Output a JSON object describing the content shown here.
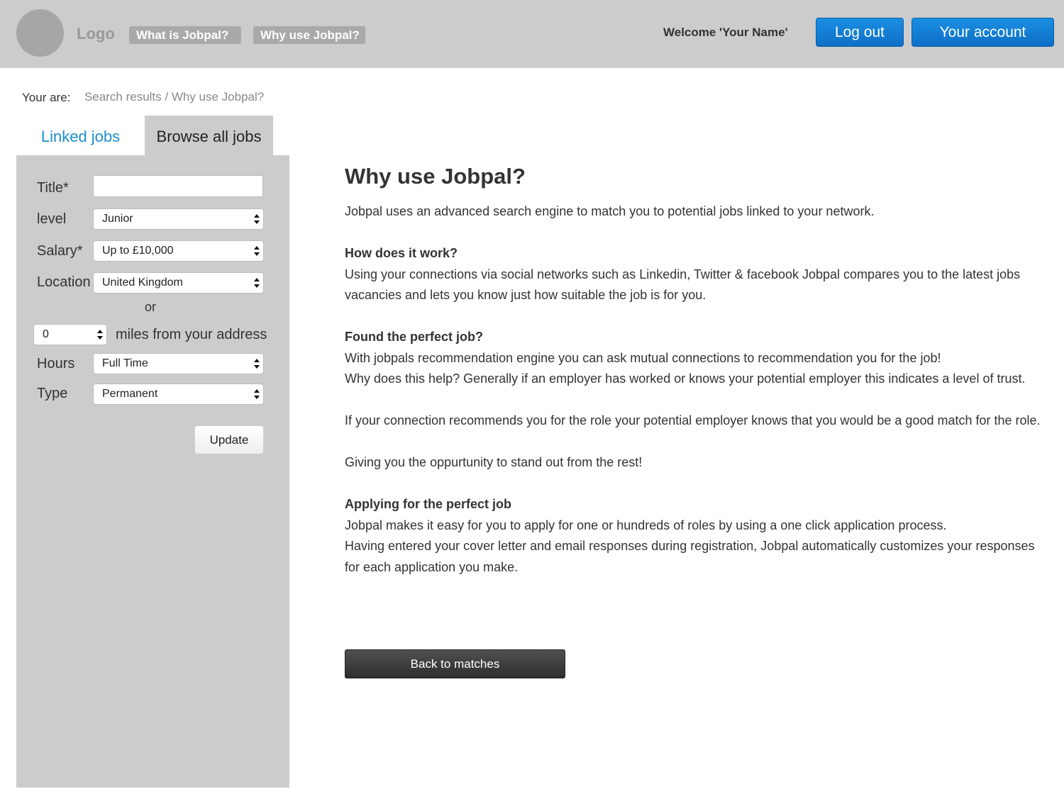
{
  "header": {
    "logo": "Logo",
    "nav": [
      "What is Jobpal?",
      "Why use Jobpal?"
    ],
    "welcome": "Welcome 'Your Name'",
    "logout_label": "Log out",
    "account_label": "Your account"
  },
  "breadcrumb": {
    "label": "Your are:",
    "path": "Search results / Why use Jobpal?"
  },
  "tabs": {
    "linked": "Linked jobs",
    "browse": "Browse all jobs"
  },
  "filters": {
    "title_label": "Title*",
    "title_value": "",
    "level_label": "level",
    "level_value": "Junior",
    "salary_label": "Salary*",
    "salary_value": "Up to £10,000",
    "location_label": "Location",
    "location_value": "United Kingdom",
    "or_text": "or",
    "miles_value": "0",
    "miles_label": "miles from your address",
    "hours_label": "Hours",
    "hours_value": "Full Time",
    "type_label": "Type",
    "type_value": "Permanent",
    "update_label": "Update"
  },
  "content": {
    "title": "Why use Jobpal?",
    "intro": "Jobpal uses an advanced search engine to match you to potential jobs linked to your network.",
    "how_heading": "How does it work?",
    "how_text": "Using your connections via social networks such as Linkedin, Twitter & facebook Jobpal compares you to the latest jobs vacancies and lets you know just how suitable the job is for you.",
    "found_heading": "Found the perfect job?",
    "found_text_1": "With jobpals recommendation engine you can ask mutual connections to recommendation you for the job!",
    "found_text_2": "Why does this help? Generally if an employer has worked or knows your potential employer this indicates a level of trust.",
    "recommend_text": "If your connection recommends you for the role your potential employer knows that you would be a good match for the role.",
    "standout_text": "Giving you the oppurtunity to stand out from the rest!",
    "apply_heading": "Applying for the perfect job",
    "apply_text_1": "Jobpal makes it easy for you to apply for one or hundreds of roles by using a one click application process.",
    "apply_text_2": "Having entered your cover letter and email responses during registration, Jobpal automatically customizes your responses for each application you make.",
    "back_label": "Back to matches"
  },
  "colors": {
    "header_bg": "#cccccc",
    "accent_blue": "#1a8fe3",
    "link_blue": "#1a8fd0",
    "dark_button": "#3a3a3a"
  }
}
